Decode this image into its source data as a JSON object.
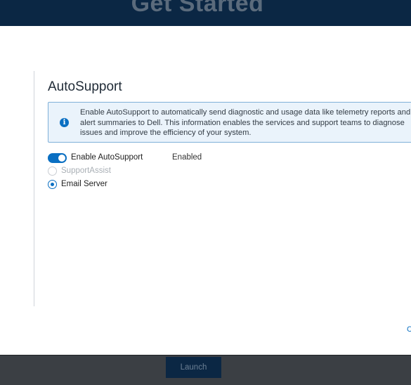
{
  "banner": {
    "title": "Get Started"
  },
  "autosupport": {
    "title": "AutoSupport",
    "info_text": "Enable AutoSupport to automatically send diagnostic and usage data like telemetry reports and alert summaries to Dell. This information enables the services and support teams to diagnose issues and improve the efficiency of your system.",
    "toggle_label": "Enable AutoSupport",
    "toggle_state": "Enabled",
    "options": [
      {
        "label": "SupportAssist",
        "selected": false,
        "disabled": true
      },
      {
        "label": "Email Server",
        "selected": true,
        "disabled": false
      }
    ]
  },
  "cut_link": "C",
  "footer": {
    "launch_label": "Launch"
  },
  "colors": {
    "accent": "#0a6fc2",
    "banner": "#0b2744",
    "info_bg": "#eaf3fb",
    "footer": "#3b3f44"
  }
}
